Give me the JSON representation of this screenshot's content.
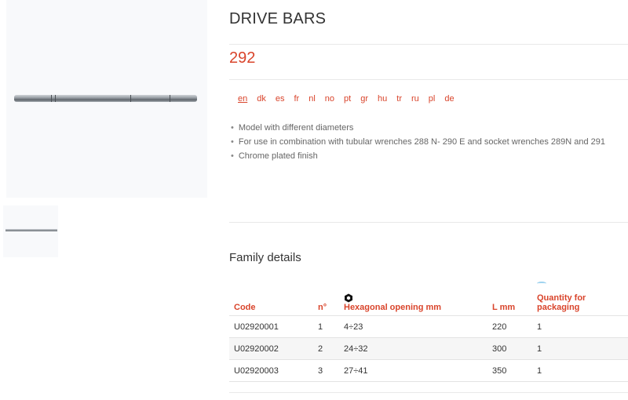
{
  "page": {
    "title": "DRIVE BARS",
    "model_number": "292"
  },
  "languages": [
    "en",
    "dk",
    "es",
    "fr",
    "nl",
    "no",
    "pt",
    "gr",
    "hu",
    "tr",
    "ru",
    "pl",
    "de"
  ],
  "active_language": "en",
  "features": [
    "Model with different diameters",
    "For use in combination with tubular wrenches 288 N- 290 E and socket wrenches 289N and 291",
    "Chrome plated finish"
  ],
  "family": {
    "title": "Family details",
    "headers": {
      "code": "Code",
      "number": "n°",
      "hex_opening": "Hexagonal opening mm",
      "length": "L mm",
      "quantity": "Quantity for packaging"
    },
    "rows": [
      {
        "code": "U02920001",
        "number": "1",
        "hex_opening": "4÷23",
        "length": "220",
        "quantity": "1"
      },
      {
        "code": "U02920002",
        "number": "2",
        "hex_opening": "24÷32",
        "length": "300",
        "quantity": "1"
      },
      {
        "code": "U02920003",
        "number": "3",
        "hex_opening": "27÷41",
        "length": "350",
        "quantity": "1"
      }
    ]
  },
  "icons": {
    "hex_icon": "hex-nut-icon",
    "packaging_icon": "packaging-icon"
  },
  "colors": {
    "accent": "#d9442b",
    "text": "#333333",
    "muted": "#666666"
  }
}
